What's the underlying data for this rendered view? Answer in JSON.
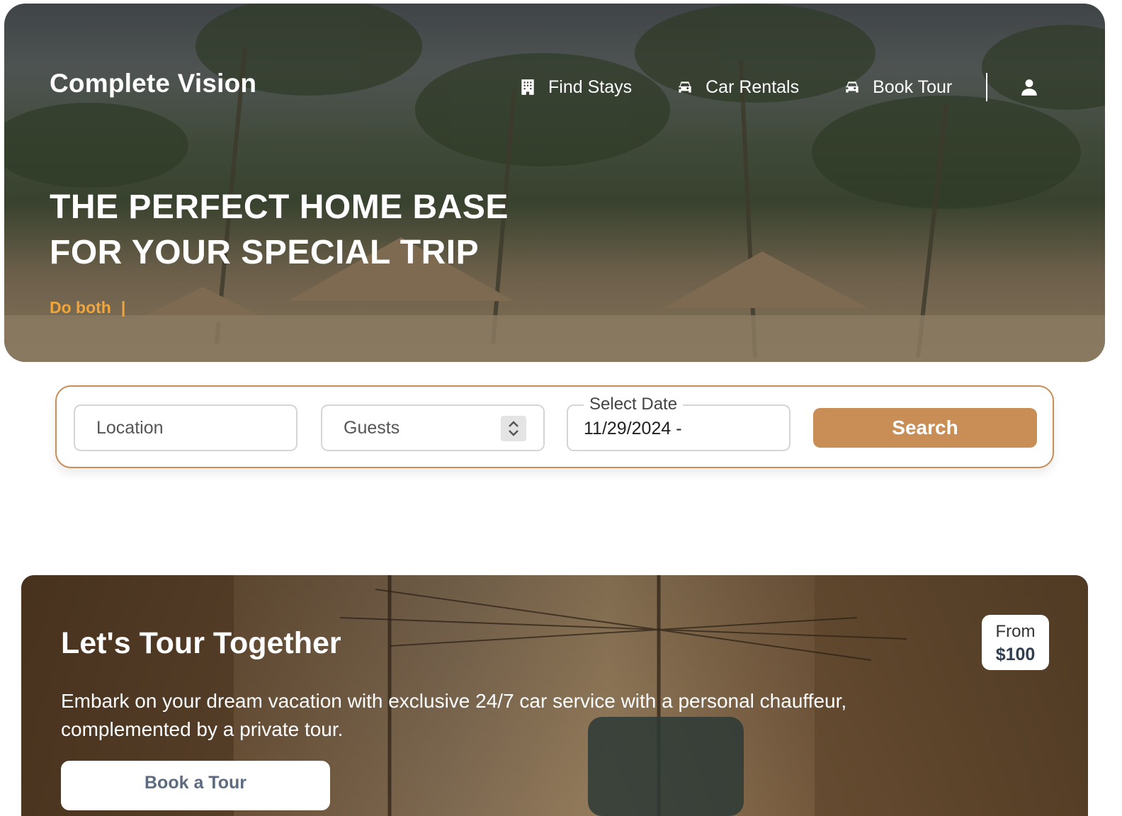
{
  "header": {
    "brand": "Complete Vision",
    "nav": [
      {
        "label": "Find Stays",
        "icon": "building-icon"
      },
      {
        "label": "Car Rentals",
        "icon": "car-icon"
      },
      {
        "label": "Book Tour",
        "icon": "car-icon"
      }
    ],
    "user_icon": "user-icon"
  },
  "hero": {
    "headline_line1": "THE PERFECT HOME BASE",
    "headline_line2": "FOR YOUR SPECIAL TRIP",
    "typing_text": "Do both",
    "typing_caret": "|"
  },
  "search": {
    "location_placeholder": "Location",
    "guests_placeholder": "Guests",
    "date_label": "Select Date",
    "date_value": "11/29/2024 -",
    "button_label": "Search"
  },
  "tour": {
    "title": "Let's Tour Together",
    "description": "Embark on your dream vacation with exclusive 24/7 car service with a personal chauffeur, complemented by a private tour.",
    "button_label": "Book a Tour",
    "price_prefix": "From",
    "price": "$100"
  },
  "colors": {
    "accent": "#c98d56",
    "typing": "#f0a63a",
    "tour_button_text": "#5c6b80"
  }
}
